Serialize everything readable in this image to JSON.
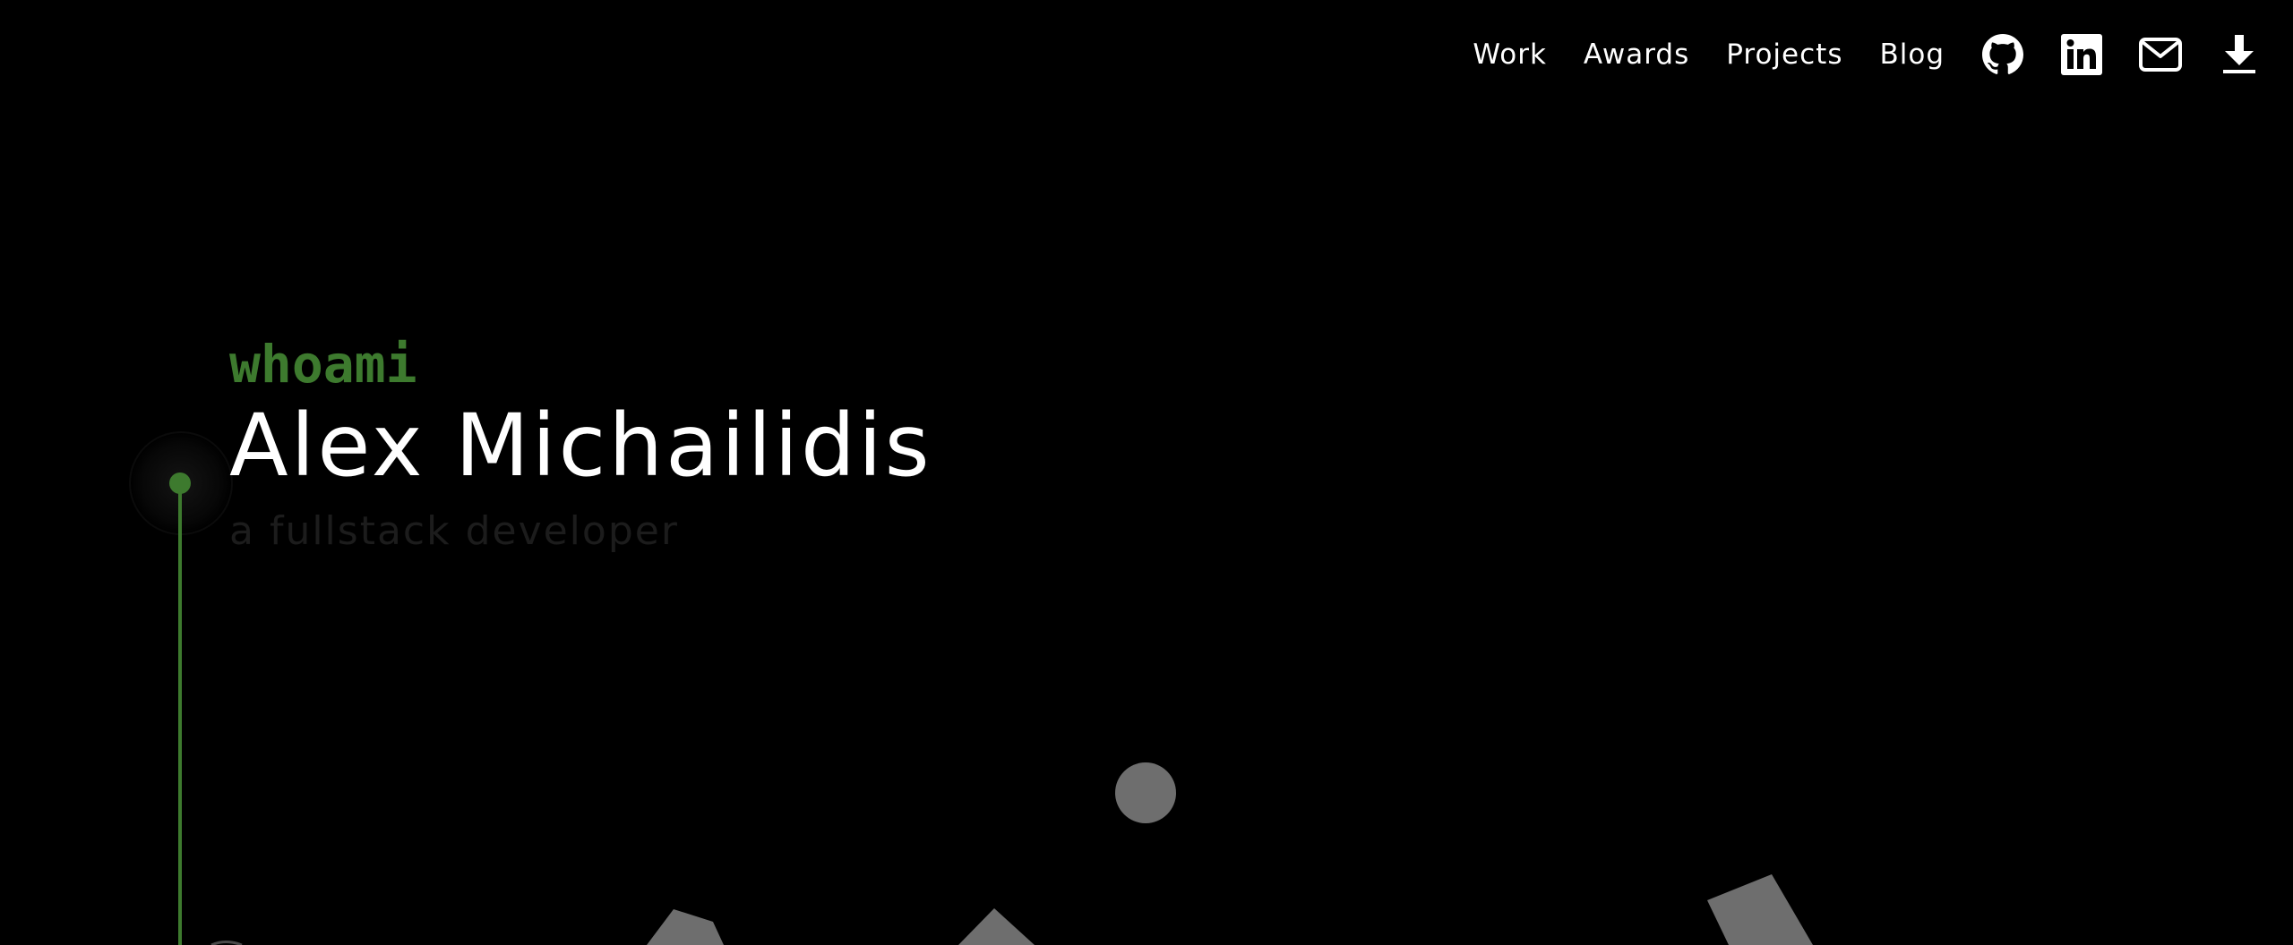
{
  "nav": {
    "links": [
      {
        "label": "Work"
      },
      {
        "label": "Awards"
      },
      {
        "label": "Projects"
      },
      {
        "label": "Blog"
      }
    ],
    "icons": [
      "github-icon",
      "linkedin-icon",
      "mail-icon",
      "download-icon"
    ]
  },
  "hero": {
    "command": "whoami",
    "name": "Alex Michailidis",
    "tagline": "a fullstack developer"
  },
  "colors": {
    "background": "#000000",
    "accent": "#3d7a2e",
    "text": "#ffffff",
    "tagline": "#1c1c1c",
    "shape": "#6e6e6e"
  }
}
